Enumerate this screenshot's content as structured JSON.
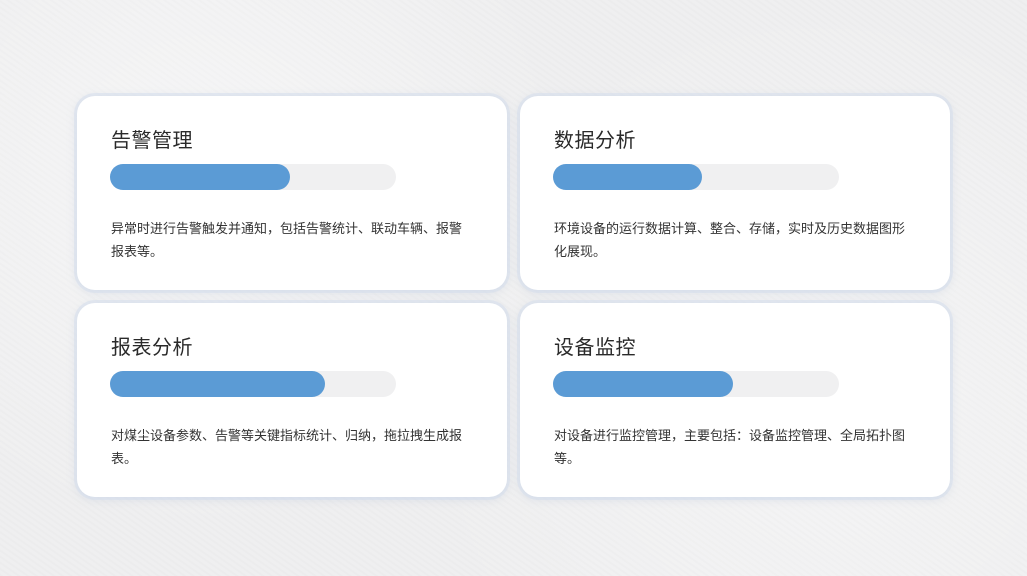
{
  "colors": {
    "accent": "#5b9bd5",
    "track": "#f0f0f1",
    "card": "#ffffff",
    "text": "#333333"
  },
  "cards": [
    {
      "title": "告警管理",
      "progress": 0.63,
      "description": "异常时进行告警触发并通知，包括告警统计、联动车辆、报警报表等。"
    },
    {
      "title": "数据分析",
      "progress": 0.52,
      "description": "环境设备的运行数据计算、整合、存储，实时及历史数据图形化展现。"
    },
    {
      "title": "报表分析",
      "progress": 0.75,
      "description": "对煤尘设备参数、告警等关键指标统计、归纳，拖拉拽生成报表。"
    },
    {
      "title": "设备监控",
      "progress": 0.63,
      "description": "对设备进行监控管理，主要包括：设备监控管理、全局拓扑图等。"
    }
  ]
}
